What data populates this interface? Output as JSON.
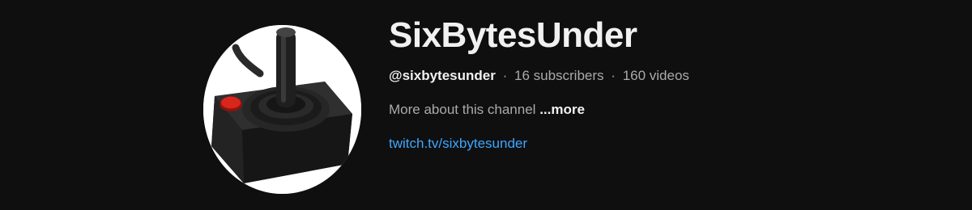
{
  "channel": {
    "name": "SixBytesUnder",
    "handle": "@sixbytesunder",
    "separator": "·",
    "subscribers": "16 subscribers",
    "videos": "160 videos",
    "description": "More about this channel",
    "more_label": "...more",
    "link": "twitch.tv/sixbytesunder",
    "avatar_icon": "joystick-icon"
  },
  "colors": {
    "background": "#0f0f0f",
    "title_text": "#f1f1f1",
    "secondary_text": "#aaaaaa",
    "link": "#3ea6ff",
    "joystick_button": "#d8261c"
  }
}
